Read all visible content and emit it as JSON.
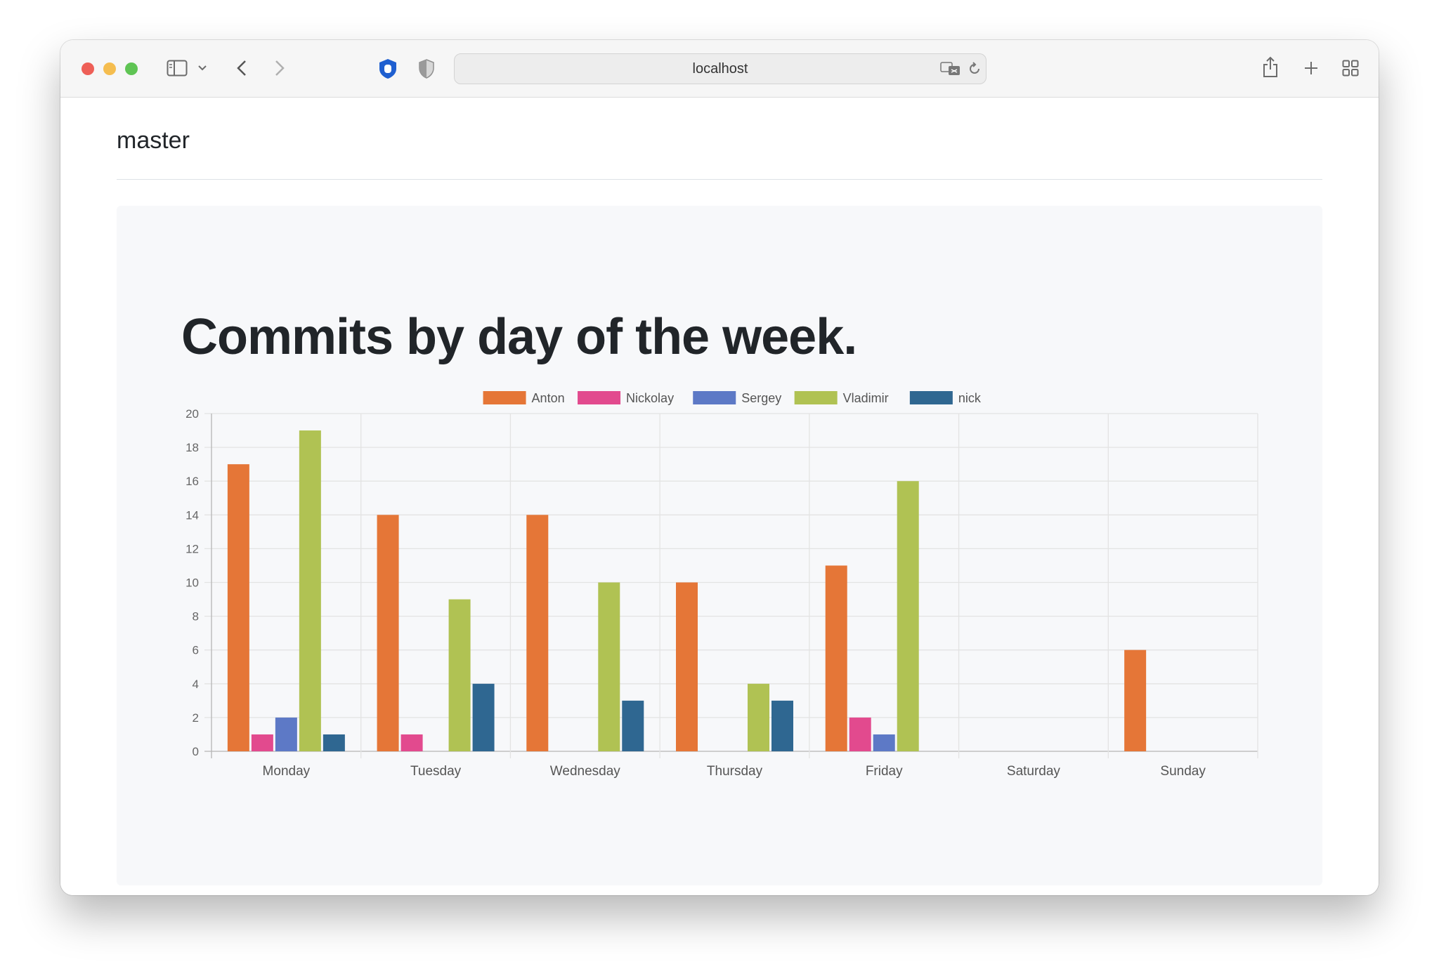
{
  "browser": {
    "url": "localhost"
  },
  "page": {
    "branch": "master"
  },
  "chart_data": {
    "type": "bar",
    "title": "Commits by day of the week.",
    "categories": [
      "Monday",
      "Tuesday",
      "Wednesday",
      "Thursday",
      "Friday",
      "Saturday",
      "Sunday"
    ],
    "series": [
      {
        "name": "Anton",
        "color": "#e57637",
        "values": [
          17,
          14,
          14,
          10,
          11,
          0,
          6
        ]
      },
      {
        "name": "Nickolay",
        "color": "#e24a8e",
        "values": [
          1,
          1,
          0,
          0,
          2,
          0,
          0
        ]
      },
      {
        "name": "Sergey",
        "color": "#5d79c6",
        "values": [
          2,
          0,
          0,
          0,
          1,
          0,
          0
        ]
      },
      {
        "name": "Vladimir",
        "color": "#b0c253",
        "values": [
          19,
          9,
          10,
          4,
          16,
          0,
          0
        ]
      },
      {
        "name": "nick",
        "color": "#2f6791",
        "values": [
          1,
          4,
          3,
          3,
          0,
          0,
          0
        ]
      }
    ],
    "ylim": [
      0,
      20
    ],
    "yticks": [
      "0",
      "2",
      "4",
      "6",
      "8",
      "10",
      "12",
      "14",
      "16",
      "18",
      "20"
    ],
    "legend_position": "top",
    "grid": true
  }
}
